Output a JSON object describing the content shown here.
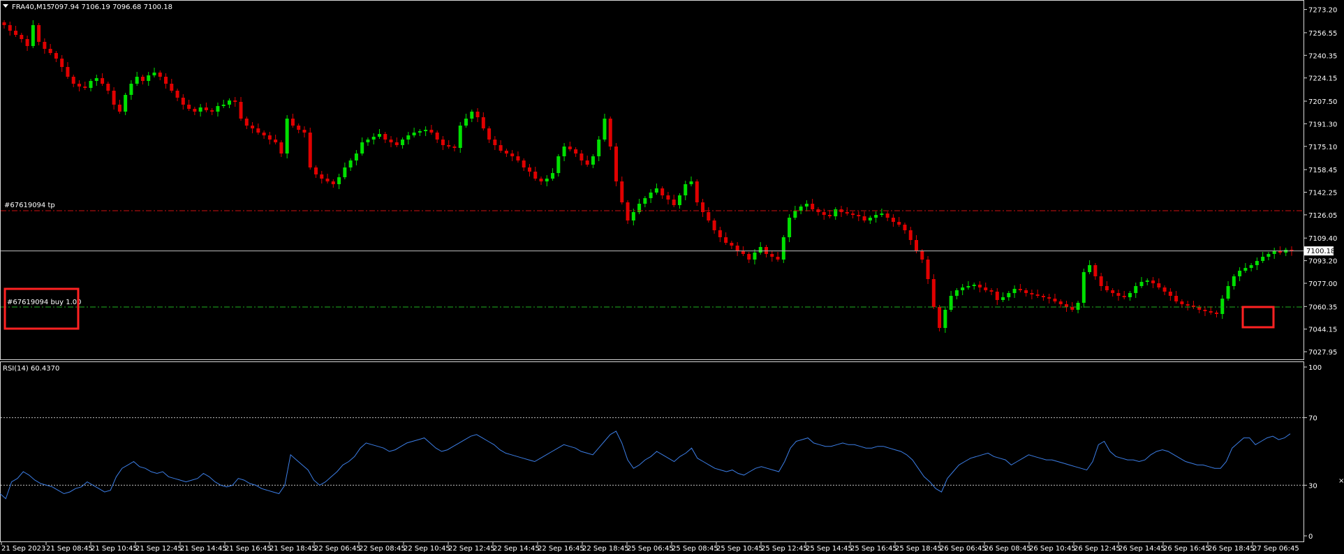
{
  "header": {
    "symbol": "FRA40,M15",
    "ohlc": "7097.94 7106.19 7096.68 7100.18"
  },
  "rsi_header": "RSI(14) 60.4370",
  "colors": {
    "background": "#000000",
    "bull": "#00e000",
    "bear": "#e00000",
    "rsi_line": "#3c7ee6",
    "tp_line": "#d01010",
    "entry_line": "#20b020",
    "price_line": "#c0c0c0",
    "highlight_box": "#ff2222"
  },
  "annotations": {
    "tp_label": "#67619094 tp",
    "order_label": "#67619094 buy 1.00"
  },
  "price_tag": "7100.18",
  "chart_data": [
    {
      "type": "candlestick",
      "title": "",
      "price_axis_ticks": [
        "7273.20",
        "7256.55",
        "7240.35",
        "7224.15",
        "7207.50",
        "7191.30",
        "7175.10",
        "7158.45",
        "7142.25",
        "7126.05",
        "7109.40",
        "7093.20",
        "7077.00",
        "7060.35",
        "7044.15",
        "7027.95"
      ],
      "ylim": [
        7024,
        7278
      ],
      "tp_level": 7129,
      "entry_level": 7060,
      "current_price": 7100.18,
      "close": [
        7262,
        7258,
        7255,
        7252,
        7247,
        7262,
        7250,
        7245,
        7242,
        7238,
        7232,
        7225,
        7220,
        7218,
        7217,
        7222,
        7224,
        7220,
        7215,
        7205,
        7200,
        7212,
        7220,
        7225,
        7222,
        7226,
        7228,
        7225,
        7220,
        7215,
        7210,
        7205,
        7202,
        7200,
        7203,
        7201,
        7200,
        7204,
        7205,
        7208,
        7207,
        7195,
        7190,
        7188,
        7185,
        7183,
        7180,
        7178,
        7170,
        7195,
        7190,
        7187,
        7185,
        7160,
        7155,
        7152,
        7150,
        7148,
        7153,
        7160,
        7165,
        7170,
        7178,
        7180,
        7182,
        7184,
        7180,
        7178,
        7176,
        7180,
        7183,
        7185,
        7186,
        7187,
        7185,
        7180,
        7176,
        7175,
        7174,
        7190,
        7195,
        7200,
        7196,
        7188,
        7180,
        7176,
        7172,
        7170,
        7168,
        7165,
        7160,
        7157,
        7152,
        7150,
        7152,
        7156,
        7168,
        7175,
        7173,
        7170,
        7165,
        7162,
        7168,
        7180,
        7195,
        7175,
        7150,
        7135,
        7122,
        7128,
        7134,
        7138,
        7142,
        7145,
        7140,
        7137,
        7133,
        7140,
        7148,
        7150,
        7135,
        7128,
        7122,
        7115,
        7110,
        7106,
        7104,
        7100,
        7098,
        7094,
        7099,
        7103,
        7098,
        7096,
        7094,
        7110,
        7124,
        7129,
        7132,
        7134,
        7130,
        7128,
        7126,
        7125,
        7130,
        7128,
        7127,
        7126,
        7125,
        7122,
        7124,
        7126,
        7127,
        7124,
        7121,
        7119,
        7115,
        7108,
        7100,
        7094,
        7080,
        7060,
        7045,
        7058,
        7068,
        7072,
        7074,
        7075,
        7076,
        7074,
        7072,
        7071,
        7065,
        7067,
        7070,
        7073,
        7072,
        7070,
        7069,
        7068,
        7067,
        7066,
        7064,
        7062,
        7060,
        7058,
        7063,
        7085,
        7090,
        7082,
        7075,
        7072,
        7070,
        7068,
        7067,
        7070,
        7075,
        7078,
        7079,
        7077,
        7074,
        7071,
        7068,
        7064,
        7062,
        7061,
        7060,
        7058,
        7057,
        7056,
        7055,
        7066,
        7075,
        7082,
        7086,
        7088,
        7090,
        7093,
        7096,
        7098,
        7100,
        7099,
        7101,
        7100.18
      ]
    },
    {
      "type": "line",
      "title": "RSI(14)",
      "ylim": [
        0,
        100
      ],
      "levels": [
        30,
        70
      ],
      "y_ticks": [
        "100",
        "70",
        "30",
        "0"
      ],
      "x_tick_labels": [
        "21 Sep 2023",
        "21 Sep 08:45",
        "21 Sep 10:45",
        "21 Sep 12:45",
        "21 Sep 14:45",
        "21 Sep 16:45",
        "21 Sep 18:45",
        "22 Sep 06:45",
        "22 Sep 08:45",
        "22 Sep 10:45",
        "22 Sep 12:45",
        "22 Sep 14:45",
        "22 Sep 16:45",
        "22 Sep 18:45",
        "25 Sep 06:45",
        "25 Sep 08:45",
        "25 Sep 10:45",
        "25 Sep 12:45",
        "25 Sep 14:45",
        "25 Sep 16:45",
        "25 Sep 18:45",
        "26 Sep 06:45",
        "26 Sep 08:45",
        "26 Sep 10:45",
        "26 Sep 12:45",
        "26 Sep 14:45",
        "26 Sep 16:45",
        "26 Sep 18:45",
        "27 Sep 06:45"
      ],
      "values": [
        25,
        22,
        32,
        34,
        38,
        36,
        33,
        31,
        30,
        29,
        27,
        25,
        26,
        28,
        29,
        32,
        30,
        28,
        26,
        27,
        35,
        40,
        42,
        44,
        41,
        40,
        38,
        37,
        38,
        35,
        34,
        33,
        32,
        33,
        34,
        37,
        35,
        32,
        30,
        29,
        30,
        34,
        33,
        31,
        30,
        28,
        27,
        26,
        25,
        30,
        48,
        45,
        42,
        39,
        33,
        30,
        32,
        35,
        38,
        42,
        44,
        47,
        52,
        55,
        54,
        53,
        52,
        50,
        51,
        53,
        55,
        56,
        57,
        58,
        55,
        52,
        50,
        51,
        53,
        55,
        57,
        59,
        60,
        58,
        56,
        54,
        51,
        49,
        48,
        47,
        46,
        45,
        44,
        46,
        48,
        50,
        52,
        54,
        53,
        52,
        50,
        49,
        48,
        52,
        56,
        60,
        62,
        55,
        45,
        40,
        42,
        45,
        47,
        50,
        48,
        46,
        44,
        47,
        49,
        52,
        46,
        44,
        42,
        40,
        39,
        38,
        39,
        37,
        36,
        38,
        40,
        41,
        40,
        39,
        38,
        44,
        52,
        56,
        57,
        58,
        55,
        54,
        53,
        53,
        54,
        55,
        54,
        54,
        53,
        52,
        52,
        53,
        53,
        52,
        51,
        50,
        48,
        45,
        40,
        35,
        32,
        28,
        26,
        34,
        38,
        42,
        44,
        46,
        47,
        48,
        49,
        47,
        46,
        45,
        42,
        44,
        46,
        48,
        47,
        46,
        45,
        45,
        44,
        43,
        42,
        41,
        40,
        39,
        44,
        54,
        56,
        50,
        47,
        46,
        45,
        45,
        44,
        45,
        48,
        50,
        51,
        50,
        48,
        46,
        44,
        43,
        42,
        42,
        41,
        40,
        40,
        44,
        52,
        55,
        58,
        58,
        54,
        56,
        58,
        59,
        57,
        58,
        60.437
      ]
    }
  ]
}
